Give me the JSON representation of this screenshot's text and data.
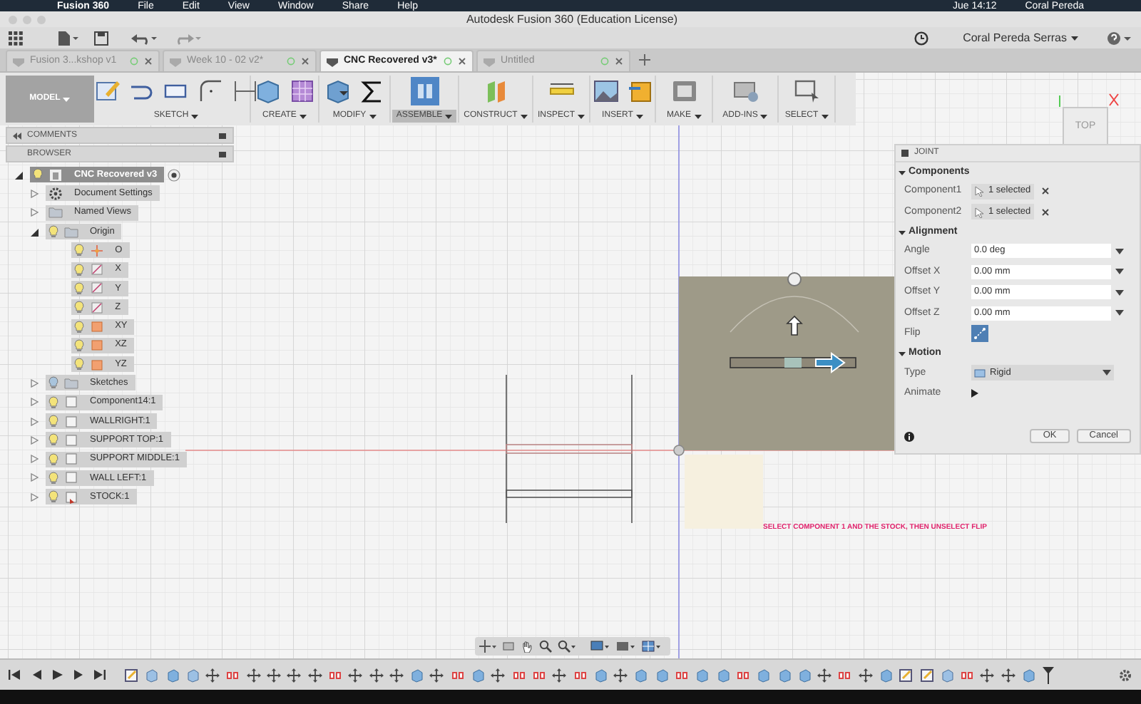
{
  "menu_bar": {
    "app": "Fusion 360",
    "menus": [
      "File",
      "Edit",
      "View",
      "Window",
      "Share",
      "Help"
    ],
    "clock": "Jue 14:12",
    "user": "Coral Pereda"
  },
  "window": {
    "title": "Autodesk Fusion 360 (Education License)"
  },
  "toolbar": {
    "account": "Coral Pereda Serras"
  },
  "tabs": [
    {
      "label": "Fusion 3...kshop v1",
      "selected": false
    },
    {
      "label": "Week 10 - 02 v2*",
      "selected": false
    },
    {
      "label": "CNC Recovered v3*",
      "selected": true
    },
    {
      "label": "Untitled",
      "selected": false
    }
  ],
  "ribbon": {
    "workspace": "MODEL",
    "groups": [
      {
        "label": "SKETCH",
        "selected": false
      },
      {
        "label": "CREATE",
        "selected": false
      },
      {
        "label": "MODIFY",
        "selected": false
      },
      {
        "label": "ASSEMBLE",
        "selected": true
      },
      {
        "label": "CONSTRUCT",
        "selected": false
      },
      {
        "label": "INSPECT",
        "selected": false
      },
      {
        "label": "INSERT",
        "selected": false
      },
      {
        "label": "MAKE",
        "selected": false
      },
      {
        "label": "ADD-INS",
        "selected": false
      },
      {
        "label": "SELECT",
        "selected": false
      }
    ]
  },
  "panels": [
    {
      "label": "COMMENTS"
    },
    {
      "label": "BROWSER"
    }
  ],
  "browser": {
    "items": [
      {
        "label": "CNC Recovered v3",
        "kind": "root",
        "selected": true,
        "expanded": true,
        "visible": true,
        "children": [
          {
            "label": "Document Settings",
            "kind": "settings",
            "selected": false,
            "expanded": false
          },
          {
            "label": "Named Views",
            "kind": "folder",
            "selected": false,
            "expanded": false
          },
          {
            "label": "Origin",
            "kind": "folder",
            "selected": false,
            "expanded": true,
            "visible": true,
            "children": [
              {
                "label": "O",
                "kind": "point",
                "selected": false,
                "visible": true
              },
              {
                "label": "X",
                "kind": "axis",
                "selected": false,
                "visible": true
              },
              {
                "label": "Y",
                "kind": "axis",
                "selected": false,
                "visible": true
              },
              {
                "label": "Z",
                "kind": "axis",
                "selected": false,
                "visible": true
              },
              {
                "label": "XY",
                "kind": "plane",
                "selected": false,
                "visible": true
              },
              {
                "label": "XZ",
                "kind": "plane",
                "selected": false,
                "visible": true
              },
              {
                "label": "YZ",
                "kind": "plane",
                "selected": false,
                "visible": true
              }
            ]
          },
          {
            "label": "Sketches",
            "kind": "folder",
            "selected": false,
            "expanded": false,
            "visible": false
          },
          {
            "label": "Component14:1",
            "kind": "component",
            "selected": false,
            "expanded": false,
            "visible": true
          },
          {
            "label": "WALLRIGHT:1",
            "kind": "component",
            "selected": false,
            "expanded": false,
            "visible": true
          },
          {
            "label": "SUPPORT TOP:1",
            "kind": "component",
            "selected": false,
            "expanded": false,
            "visible": true
          },
          {
            "label": "SUPPORT MIDDLE:1",
            "kind": "component",
            "selected": false,
            "expanded": false,
            "visible": true
          },
          {
            "label": "WALL LEFT:1",
            "kind": "component",
            "selected": false,
            "expanded": false,
            "visible": true
          },
          {
            "label": "STOCK:1",
            "kind": "component-grounded",
            "selected": false,
            "expanded": false,
            "visible": true
          }
        ]
      }
    ]
  },
  "joint": {
    "title": "JOINT",
    "sections": [
      {
        "title": "Components",
        "expanded": true,
        "rows": [
          {
            "kind": "selection",
            "label": "Component1",
            "value": "1 selected"
          },
          {
            "kind": "selection",
            "label": "Component2",
            "value": "1 selected"
          }
        ]
      },
      {
        "title": "Alignment",
        "expanded": true,
        "rows": [
          {
            "kind": "field",
            "label": "Angle",
            "value": "0.0 deg"
          },
          {
            "kind": "field",
            "label": "Offset X",
            "value": "0.00 mm"
          },
          {
            "kind": "field",
            "label": "Offset Y",
            "value": "0.00 mm"
          },
          {
            "kind": "field",
            "label": "Offset Z",
            "value": "0.00 mm"
          },
          {
            "kind": "toggle",
            "label": "Flip",
            "on": true
          }
        ]
      },
      {
        "title": "Motion",
        "expanded": true,
        "rows": [
          {
            "kind": "dropdown",
            "label": "Type",
            "value": "Rigid"
          },
          {
            "kind": "play",
            "label": "Animate"
          }
        ]
      }
    ],
    "buttons": [
      "OK",
      "Cancel"
    ]
  },
  "view_cube": {
    "face": "TOP"
  },
  "canvas": {
    "hint": "SELECT COMPONENT 1 AND THE STOCK, THEN UNSELECT FLIP"
  }
}
